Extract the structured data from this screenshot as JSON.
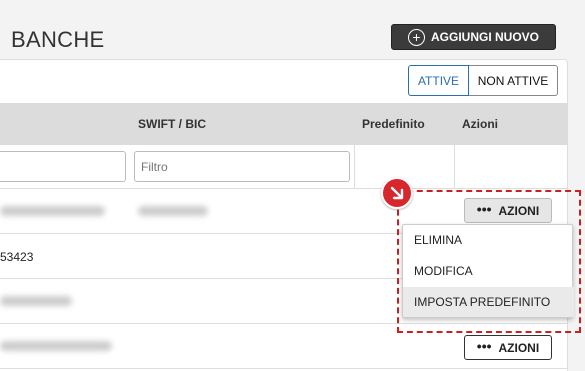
{
  "page": {
    "title": "BANCHE",
    "add_button_label": "AGGIUNGI NUOVO",
    "add_icon": "plus-circle-icon"
  },
  "status_toggle": {
    "active_label": "ATTIVE",
    "inactive_label": "NON ATTIVE",
    "selected": "ATTIVE",
    "accent_color": "#2a6db0"
  },
  "table": {
    "columns": [
      "SWIFT / BIC",
      "Predefinito",
      "Azioni"
    ],
    "filter_placeholder": "Filtro",
    "rows": [
      {
        "visible_text": "",
        "blurred": true
      },
      {
        "visible_text": "53423",
        "blurred": false
      },
      {
        "visible_text": "",
        "blurred": true
      },
      {
        "visible_text": "",
        "blurred": true
      }
    ],
    "actions_button_label": "AZIONI",
    "actions_icon": "ellipsis-icon"
  },
  "actions_menu": {
    "items": [
      "ELIMINA",
      "MODIFICA",
      "IMPOSTA PREDEFINITO"
    ],
    "hovered_item": "IMPOSTA PREDEFINITO"
  },
  "annotation": {
    "color": "#cc1f1f",
    "icon": "arrow-down-right-icon"
  }
}
